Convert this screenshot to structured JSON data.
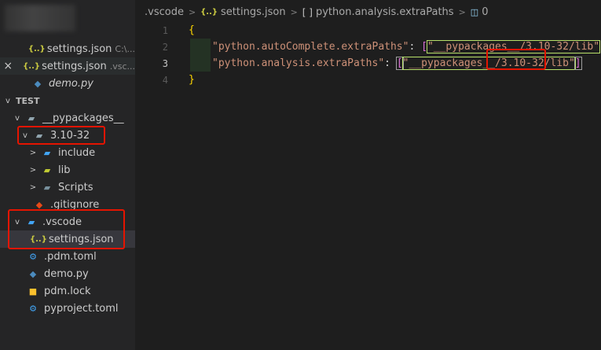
{
  "sidebar": {
    "open_editors": [
      {
        "label": "settings.json",
        "desc": "C:\\...",
        "icon": "json-icon"
      },
      {
        "label": "settings.json",
        "desc": ".vsc...",
        "icon": "json-icon",
        "close": "×"
      },
      {
        "label": "demo.py",
        "desc": "",
        "icon": "python-icon"
      }
    ],
    "section_title": "TEST",
    "tree": [
      {
        "label": "__pypackages__",
        "level": 1,
        "chevron": "v",
        "icon": "folder-icon"
      },
      {
        "label": "3.10-32",
        "level": 2,
        "chevron": "v",
        "icon": "folder-icon"
      },
      {
        "label": "include",
        "level": 3,
        "chevron": ">",
        "icon": "folder-include-icon"
      },
      {
        "label": "lib",
        "level": 3,
        "chevron": ">",
        "icon": "folder-lib-icon"
      },
      {
        "label": "Scripts",
        "level": 3,
        "chevron": ">",
        "icon": "folder-scripts-icon"
      },
      {
        "label": ".gitignore",
        "level": 2,
        "chevron": "",
        "icon": "git-icon"
      },
      {
        "label": ".vscode",
        "level": 1,
        "chevron": "v",
        "icon": "vscode-folder-icon"
      },
      {
        "label": "settings.json",
        "level": 2,
        "chevron": "",
        "icon": "json-icon"
      },
      {
        "label": ".pdm.toml",
        "level": 1,
        "chevron": "",
        "icon": "gear-icon"
      },
      {
        "label": "demo.py",
        "level": 1,
        "chevron": "",
        "icon": "python-icon"
      },
      {
        "label": "pdm.lock",
        "level": 1,
        "chevron": "",
        "icon": "lock-icon"
      },
      {
        "label": "pyproject.toml",
        "level": 1,
        "chevron": "",
        "icon": "gear-icon"
      }
    ]
  },
  "breadcrumb": {
    "folder": ".vscode",
    "file": "settings.json",
    "key": "python.analysis.extraPaths",
    "index": "0",
    "json_glyph": "{..}",
    "array_glyph": "[ ]"
  },
  "editor": {
    "line_numbers": [
      "1",
      "2",
      "3",
      "4"
    ],
    "open_brace": "{",
    "close_brace": "}",
    "key1": "\"python.autoComplete.extraPaths\"",
    "val1": "\"__pypackages__/3.10-32/lib\"",
    "key2": "\"python.analysis.extraPaths\"",
    "val2": "\"__pypackages__/3.10-32/lib\"",
    "colon": ": ",
    "lbr": "[",
    "rbr": "]"
  },
  "colors": {
    "highlight": "#e51400",
    "selected_row": "#37373d"
  }
}
